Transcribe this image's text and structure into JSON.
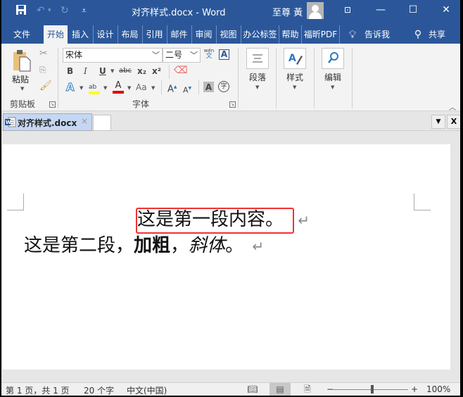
{
  "titlebar": {
    "title": "对齐样式.docx  -  Word",
    "user_name": "至尊 黃",
    "icons": {
      "save": "💾",
      "undo": "↶",
      "undo_dropdown": "▾",
      "redo": "↻",
      "customize": "⩡",
      "ribbon_display": "⊡",
      "minimize": "—",
      "maximize": "☐",
      "close": "✕"
    }
  },
  "ribbon_tabs": [
    {
      "label": "文件",
      "active": false
    },
    {
      "label": "开始",
      "active": true
    },
    {
      "label": "插入",
      "active": false
    },
    {
      "label": "设计",
      "active": false
    },
    {
      "label": "布局",
      "active": false
    },
    {
      "label": "引用",
      "active": false
    },
    {
      "label": "邮件",
      "active": false
    },
    {
      "label": "审阅",
      "active": false
    },
    {
      "label": "视图",
      "active": false
    },
    {
      "label": "办公标签",
      "active": false
    },
    {
      "label": "帮助",
      "active": false
    },
    {
      "label": "福昕PDF",
      "active": false
    }
  ],
  "tell_me": {
    "icon": "lightbulb",
    "label": "告诉我"
  },
  "share": {
    "icon": "person-plus",
    "label": "共享"
  },
  "clipboard": {
    "label": "剪贴板",
    "paste_label": "粘贴",
    "cut": "cut",
    "copy": "copy",
    "format_painter": "format-painter"
  },
  "font": {
    "label": "字体",
    "font_name": "宋体",
    "font_size": "二号",
    "phonetic": "wén",
    "phonetic_char": "文",
    "char_border": "A",
    "bold": "B",
    "italic": "I",
    "underline": "U",
    "strikethrough": "abc",
    "subscript": "x₂",
    "superscript": "x²",
    "text_effects": "A",
    "highlight": "ab",
    "font_color": "A",
    "change_case": "Aa",
    "grow_font": "A",
    "shrink_font": "A",
    "char_shading": "A",
    "enclose_char": "字",
    "highlight_color": "#ffff00",
    "font_color_value": "#e00000"
  },
  "paragraph": {
    "label": "段落"
  },
  "styles": {
    "label": "样式"
  },
  "editing": {
    "label": "编辑"
  },
  "doc_tab": {
    "label": "对齐样式.docx",
    "close": "×"
  },
  "doc_tab_controls": {
    "dropdown": "▼",
    "close": "X"
  },
  "document": {
    "para1": "这是第一段内容。",
    "para2_plain": "这是第二段，",
    "para2_bold": "加粗",
    "para2_sep": "，",
    "para2_italic": "斜体",
    "para2_end": "。",
    "para_mark": "↵"
  },
  "status": {
    "page": "第 1 页，共 1 页",
    "words": "20 个字",
    "language": "中文(中国)",
    "zoom_minus": "−",
    "zoom_plus": "+",
    "zoom": "100%",
    "zoom_level_percent": 100
  },
  "colors": {
    "accent": "#2b579a",
    "highlight_box": "#ee3333"
  }
}
